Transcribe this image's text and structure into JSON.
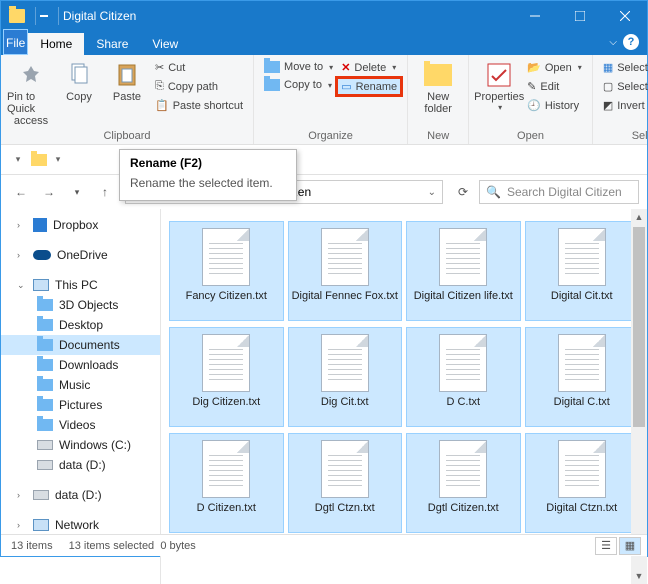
{
  "window": {
    "title": "Digital Citizen"
  },
  "tabs": {
    "file": "File",
    "home": "Home",
    "share": "Share",
    "view": "View"
  },
  "ribbon": {
    "clipboard": {
      "label": "Clipboard",
      "pin": "Pin to Quick access",
      "pin1": "Pin to Quick",
      "pin2": "access",
      "copy": "Copy",
      "paste": "Paste",
      "cut": "Cut",
      "copy_path": "Copy path",
      "paste_shortcut": "Paste shortcut"
    },
    "organize": {
      "label": "Organize",
      "move_to": "Move to",
      "copy_to": "Copy to",
      "delete": "Delete",
      "rename": "Rename"
    },
    "new": {
      "label": "New",
      "new_folder": "New folder",
      "nf1": "New",
      "nf2": "folder"
    },
    "open": {
      "label": "Open",
      "properties": "Properties",
      "open": "Open",
      "edit": "Edit",
      "history": "History"
    },
    "select": {
      "label": "Select",
      "select_all": "Select all",
      "select_none": "Select none",
      "invert": "Invert selection"
    }
  },
  "tooltip": {
    "title": "Rename (F2)",
    "body": "Rename the selected item."
  },
  "path": {
    "visible": "Citizen"
  },
  "search": {
    "placeholder": "Search Digital Citizen"
  },
  "sidebar": {
    "dropbox": "Dropbox",
    "onedrive": "OneDrive",
    "thispc": "This PC",
    "objects3d": "3D Objects",
    "desktop": "Desktop",
    "documents": "Documents",
    "downloads": "Downloads",
    "music": "Music",
    "pictures": "Pictures",
    "videos": "Videos",
    "windows_c": "Windows (C:)",
    "data_d": "data (D:)",
    "data_d2": "data (D:)",
    "network": "Network"
  },
  "files": [
    "Fancy Citizen.txt",
    "Digital Fennec Fox.txt",
    "Digital Citizen life.txt",
    "Digital Cit.txt",
    "Dig Citizen.txt",
    "Dig Cit.txt",
    "D C.txt",
    "Digital C.txt",
    "D Citizen.txt",
    "Dgtl Ctzn.txt",
    "Dgtl Citizen.txt",
    "Digital Ctzn.txt"
  ],
  "status": {
    "count": "13 items",
    "selected": "13 items selected",
    "size": "0 bytes"
  }
}
